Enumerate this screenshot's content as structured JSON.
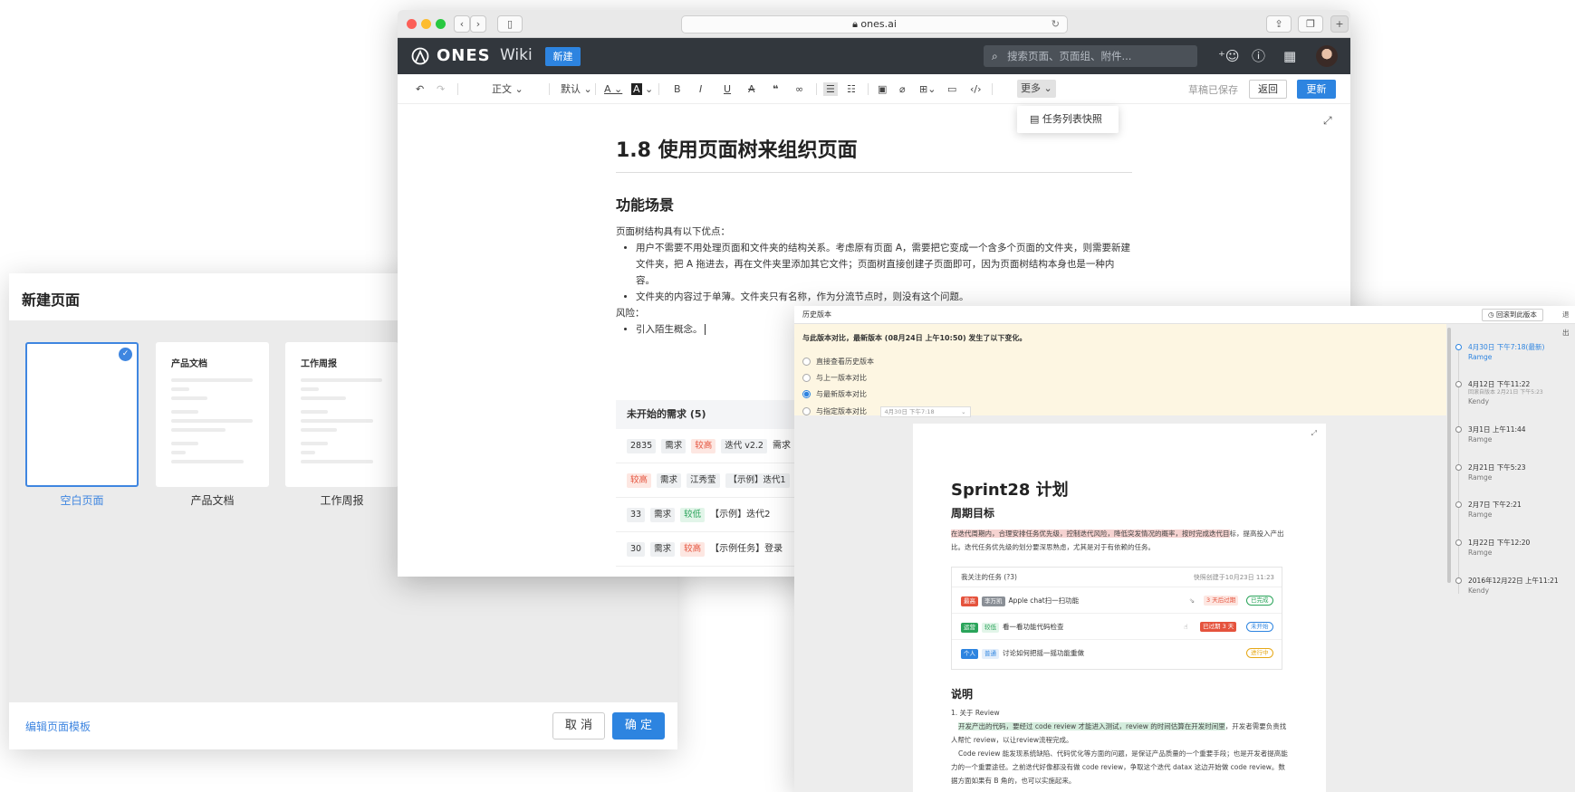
{
  "new_page_dialog": {
    "title": "新建页面",
    "templates": [
      {
        "name": "空白页面",
        "heading": "",
        "selected": true
      },
      {
        "name": "产品文档",
        "heading": "产品文档",
        "selected": false
      },
      {
        "name": "工作周报",
        "heading": "工作周报",
        "selected": false
      }
    ],
    "edit_templates_link": "编辑页面模板",
    "cancel_label": "取 消",
    "confirm_label": "确 定"
  },
  "browser": {
    "url": "ones.ai",
    "app": {
      "logo": "ONES",
      "section": "Wiki",
      "new_button": "新建",
      "search_placeholder": "搜索页面、页面组、附件..."
    },
    "toolbar": {
      "paragraph_style": "正文",
      "font": "默认",
      "more_label": "更多",
      "draft_status": "草稿已保存",
      "back_label": "返回",
      "update_label": "更新"
    },
    "more_menu": {
      "items": [
        "任务列表快照"
      ]
    },
    "document": {
      "title": "1.8 使用页面树来组织页面",
      "section_heading": "功能场景",
      "intro": "页面树结构具有以下优点：",
      "bullets": [
        "用户不需要不用处理页面和文件夹的结构关系。考虑原有页面 A，需要把它变成一个含多个页面的文件夹，则需要新建文件夹，把 A 拖进去，再在文件夹里添加其它文件；页面树直接创建子页面即可，因为页面树结构本身也是一种内容。",
        "文件夹的内容过于单薄。文件夹只有名称，作为分流节点时，则没有这个问题。"
      ],
      "risk_label": "风险：",
      "risk_bullets": [
        "引入陌生概念。"
      ]
    },
    "task_table": {
      "header": "未开始的需求 (5)",
      "rows": [
        [
          "2835",
          "需求",
          "较高",
          "迭代 v2.2",
          "需求"
        ],
        [
          "较高",
          "需求",
          "江秀莹",
          "【示例】迭代1"
        ],
        [
          "33",
          "需求",
          "较低",
          "【示例】迭代2"
        ],
        [
          "30",
          "需求",
          "较高",
          "【示例任务】登录"
        ]
      ]
    }
  },
  "history": {
    "title": "历史版本",
    "revert_label": "回滚到此版本",
    "exit_label": "退出",
    "compare": {
      "title": "与此版本对比，最新版本 (08月24日 上午10:50) 发生了以下变化。",
      "options": [
        "直接查看历史版本",
        "与上一版本对比",
        "与最新版本对比",
        "与指定版本对比"
      ],
      "selected_index": 2,
      "specified_version": "4月30日 下午7:18"
    },
    "page": {
      "title": "Sprint28 计划",
      "goal_heading": "周期目标",
      "goal_text_highlight": "在迭代周期内，合理安排任务优先级，控制迭代风险，降低突发情况的概率，按时完成迭代目",
      "goal_text_rest": "标，提高投入产出比。迭代任务优先级的划分要深思熟虑，尤其是对于有依赖的任务。",
      "snapshot": {
        "title": "我关注的任务 (?3)",
        "created": "快照创建于10月23日 11:23",
        "rows": [
          {
            "tag": "最高",
            "tag_color": "#e5533d",
            "tag2": "李万凯",
            "tag2_color": "#8a8f96",
            "text": "Apple chat扫一扫功能",
            "late": "3 天后过期",
            "status": "已完成",
            "status_color": "#2aa45a"
          },
          {
            "tag": "运营",
            "tag_color": "#2aa45a",
            "tag2": "较低",
            "tag2_color": "#2aa45a",
            "text": "看一看功能代码检查",
            "late": "已过期 3 天",
            "status": "未开始",
            "status_color": "#2d84e0"
          },
          {
            "tag": "个人",
            "tag_color": "#2d84e0",
            "tag2": "普通",
            "tag2_color": "#6fa6e8",
            "text": "讨论如何把摇一摇功能重做",
            "late": "",
            "status": "进行中",
            "status_color": "#e6a817"
          }
        ]
      },
      "desc_heading": "说明",
      "review_heading": "1. 关于 Review",
      "review_highlight": "开发产出的代码，要经过 code review 才能进入测试，review 的时间估算在开发时间里",
      "review_rest": "，开发者需要负责找人帮忙 review，以让review流程完成。",
      "review_p2": "Code review 能发现系统缺陷、代码优化等方面的问题，是保证产品质量的一个重要手段；也是开发者提高能力的一个重要途径。之前迭代好像都没有做 code review，争取这个迭代 datax 这边开始做 code review。数据方面如果有 B 角的，也可以实施起来。"
    },
    "versions": [
      {
        "date": "4月30日 下午7:18(最新)",
        "user": "Ramge",
        "note": "",
        "current": true
      },
      {
        "date": "4月12日 下午11:22",
        "user": "Kendy",
        "note": "回滚自版本 2月21日 下午5:23",
        "current": false
      },
      {
        "date": "3月1日 上午11:44",
        "user": "Ramge",
        "note": "",
        "current": false
      },
      {
        "date": "2月21日 下午5:23",
        "user": "Ramge",
        "note": "",
        "current": false
      },
      {
        "date": "2月7日 下午2:21",
        "user": "Ramge",
        "note": "",
        "current": false
      },
      {
        "date": "1月22日 下午12:20",
        "user": "Ramge",
        "note": "",
        "current": false
      },
      {
        "date": "2016年12月22日 上午11:21",
        "user": "Kendy",
        "note": "",
        "current": false
      }
    ]
  },
  "colors": {
    "accent": "#2d84e0",
    "appbar": "#32373d",
    "priority_high": "#e5533d",
    "priority_low": "#2aa45a"
  }
}
